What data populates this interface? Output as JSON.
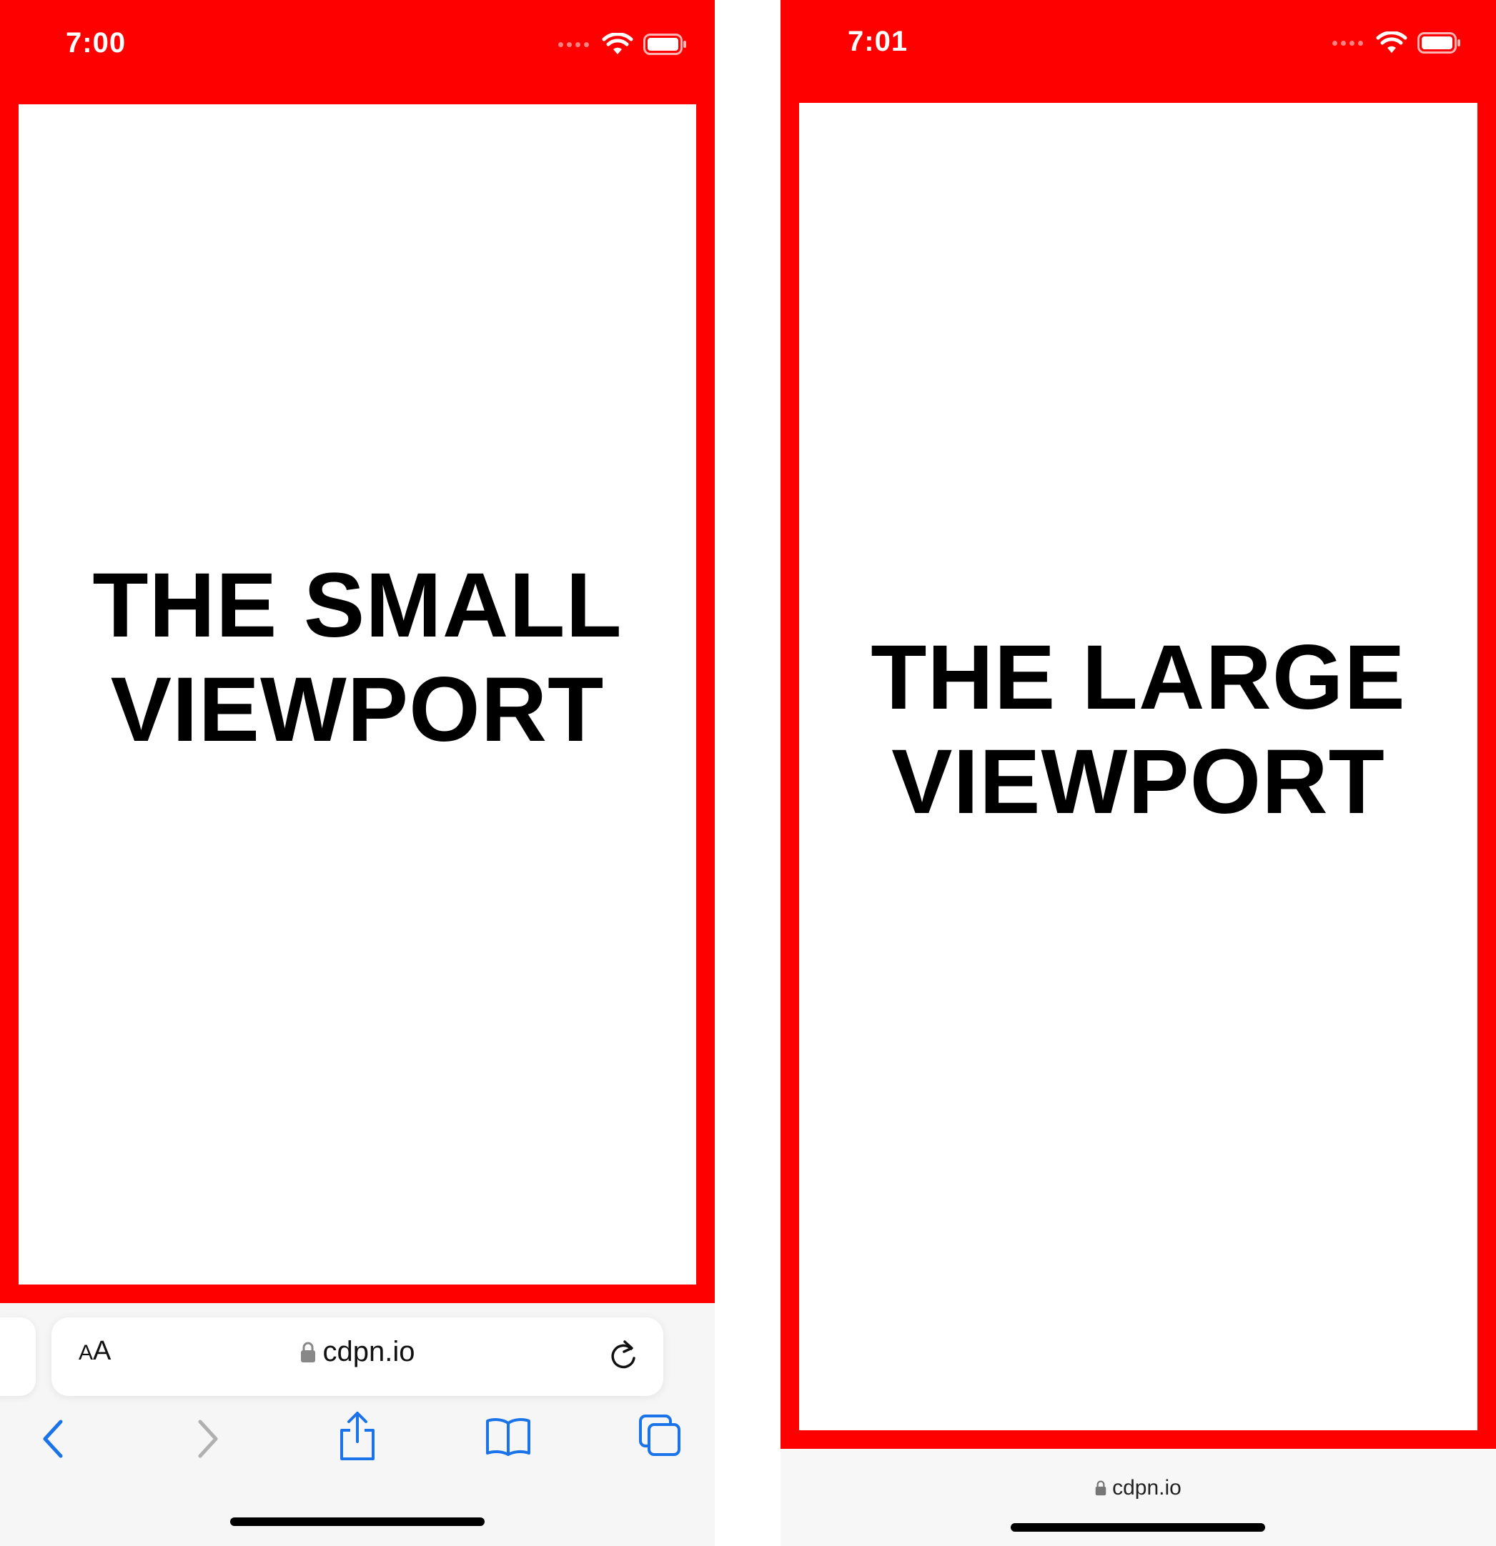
{
  "screens": [
    {
      "time": "7:00",
      "headline": "THE SMALL\nVIEWPORT",
      "address_bar": {
        "text_size_label_small": "A",
        "text_size_label_large": "A",
        "url": "cdpn.io"
      },
      "nav_icons": [
        "back-icon",
        "forward-icon",
        "share-icon",
        "bookmarks-icon",
        "tabs-icon"
      ]
    },
    {
      "time": "7:01",
      "headline": "THE LARGE\nVIEWPORT",
      "url": "cdpn.io"
    }
  ],
  "colors": {
    "frame": "#ff0000",
    "accent": "#1a73e8",
    "disabled": "#b0b0b0"
  }
}
